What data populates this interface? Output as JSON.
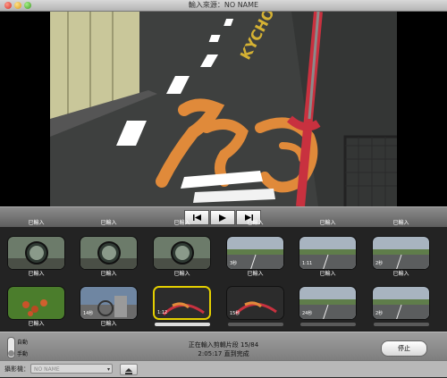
{
  "window": {
    "title": "輸入來源：NO NAME"
  },
  "icons": {
    "close": "close-icon",
    "minimize": "minimize-icon",
    "zoom": "zoom-icon",
    "prev": "skip-back-icon",
    "play": "play-icon",
    "next": "skip-forward-icon",
    "eject": "eject-icon"
  },
  "clips": [
    {
      "caption": "已輸入",
      "label": "",
      "bar": false,
      "selected": false,
      "scene": "mirror"
    },
    {
      "caption": "已輸入",
      "label": "",
      "bar": false,
      "selected": false,
      "scene": "mirror"
    },
    {
      "caption": "已輸入",
      "label": "",
      "bar": false,
      "selected": false,
      "scene": "mirror"
    },
    {
      "caption": "已輸入",
      "label": "3秒",
      "bar": false,
      "selected": false,
      "scene": "road"
    },
    {
      "caption": "已輸入",
      "label": "1:11",
      "bar": false,
      "selected": false,
      "scene": "road"
    },
    {
      "caption": "已輸入",
      "label": "2秒",
      "bar": false,
      "selected": false,
      "scene": "road"
    },
    {
      "caption": "已輸入",
      "label": "",
      "bar": false,
      "selected": false,
      "scene": "plant"
    },
    {
      "caption": "已輸入",
      "label": "14秒",
      "bar": false,
      "selected": false,
      "scene": "bike"
    },
    {
      "caption": "",
      "label": "1:12",
      "bar": true,
      "barDark": false,
      "selected": true,
      "scene": "dark"
    },
    {
      "caption": "",
      "label": "15秒",
      "bar": true,
      "barDark": true,
      "selected": false,
      "scene": "dark"
    },
    {
      "caption": "",
      "label": "24秒",
      "bar": true,
      "barDark": true,
      "selected": false,
      "scene": "road"
    },
    {
      "caption": "",
      "label": "2秒",
      "bar": true,
      "barDark": true,
      "selected": false,
      "scene": "road"
    }
  ],
  "status": {
    "line1": "正在輸入剪輯片段 15/84",
    "line2": "2:05:17 直到完成",
    "mode_auto": "自動",
    "mode_manual": "手動",
    "stop_label": "停止"
  },
  "bottom": {
    "camera_label": "攝影機：",
    "camera_value": "NO NAME"
  }
}
